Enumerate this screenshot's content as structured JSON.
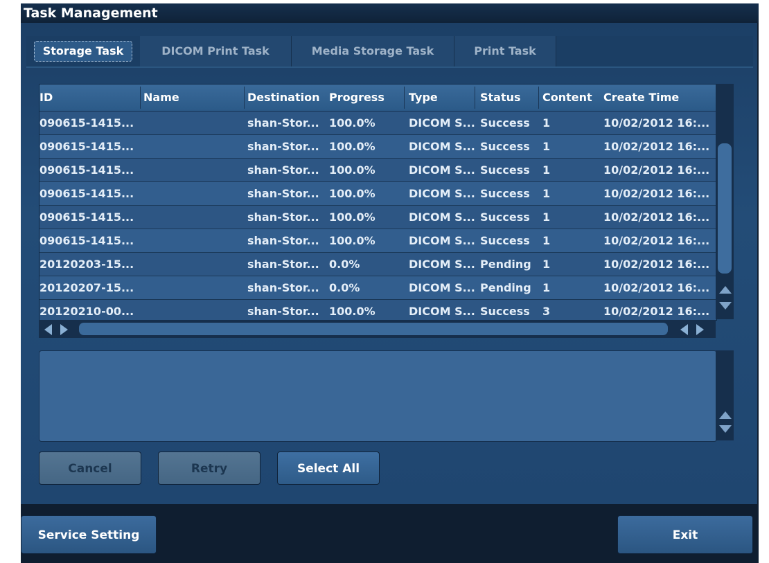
{
  "window": {
    "title": "Task Management"
  },
  "tabs": [
    {
      "label": "Storage Task",
      "active": true
    },
    {
      "label": "DICOM Print Task",
      "active": false
    },
    {
      "label": "Media Storage Task",
      "active": false
    },
    {
      "label": "Print Task",
      "active": false
    }
  ],
  "table": {
    "columns": [
      "ID",
      "Name",
      "Destination",
      "Progress",
      "Type",
      "Status",
      "Content",
      "Create Time"
    ],
    "rows": [
      [
        "090615-1415...",
        "",
        "shan-Stor...",
        "100.0%",
        "DICOM S...",
        "Success",
        "1",
        "10/02/2012 16:..."
      ],
      [
        "090615-1415...",
        "",
        "shan-Stor...",
        "100.0%",
        "DICOM S...",
        "Success",
        "1",
        "10/02/2012 16:..."
      ],
      [
        "090615-1415...",
        "",
        "shan-Stor...",
        "100.0%",
        "DICOM S...",
        "Success",
        "1",
        "10/02/2012 16:..."
      ],
      [
        "090615-1415...",
        "",
        "shan-Stor...",
        "100.0%",
        "DICOM S...",
        "Success",
        "1",
        "10/02/2012 16:..."
      ],
      [
        "090615-1415...",
        "",
        "shan-Stor...",
        "100.0%",
        "DICOM S...",
        "Success",
        "1",
        "10/02/2012 16:..."
      ],
      [
        "090615-1415...",
        "",
        "shan-Stor...",
        "100.0%",
        "DICOM S...",
        "Success",
        "1",
        "10/02/2012 16:..."
      ],
      [
        "20120203-15...",
        "",
        "shan-Stor...",
        "0.0%",
        "DICOM S...",
        "Pending",
        "1",
        "10/02/2012 16:..."
      ],
      [
        "20120207-15...",
        "",
        "shan-Stor...",
        "0.0%",
        "DICOM S...",
        "Pending",
        "1",
        "10/02/2012 16:..."
      ],
      [
        "20120210-00...",
        "",
        "shan-Stor...",
        "100.0%",
        "DICOM S...",
        "Success",
        "3",
        "10/02/2012 16:..."
      ]
    ]
  },
  "actions": {
    "cancel_label": "Cancel",
    "retry_label": "Retry",
    "select_all_label": "Select All"
  },
  "footer": {
    "service_setting_label": "Service Setting",
    "exit_label": "Exit"
  },
  "colors": {
    "panel": "#234c77",
    "header": "#2b5a88",
    "row_odd": "#2d5684",
    "row_even": "#325e8e",
    "frame": "#0f1e30"
  }
}
